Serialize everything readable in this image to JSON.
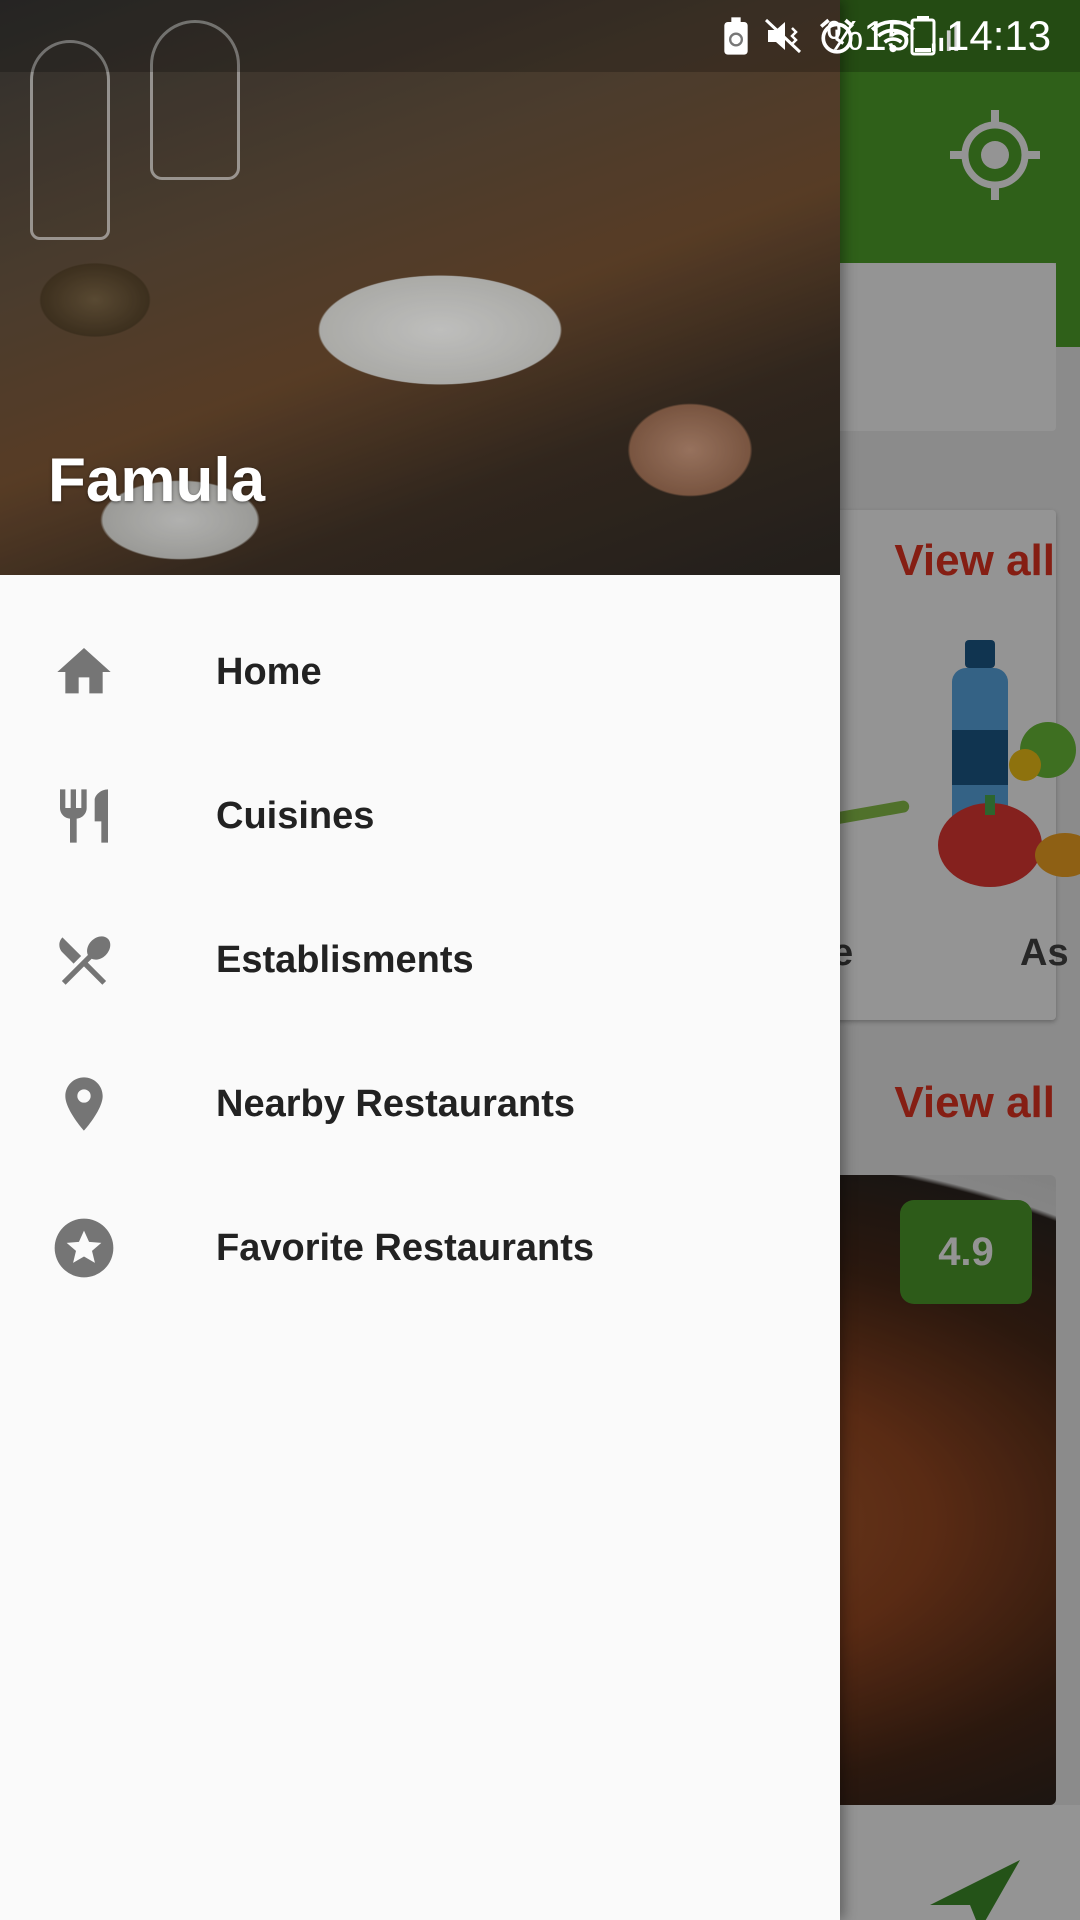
{
  "status_bar": {
    "battery": "%15",
    "time": "14:13"
  },
  "app": {
    "view_all_1": "View all",
    "view_all_2": "View all",
    "cuisine_label_1": "e",
    "cuisine_label_2": "As",
    "rating": "4.9",
    "toolbar_color": "#51a62b",
    "accent_color": "#e53422"
  },
  "drawer": {
    "title": "Famula",
    "items": [
      {
        "label": "Home",
        "icon": "home-icon"
      },
      {
        "label": "Cuisines",
        "icon": "fork-knife-icon"
      },
      {
        "label": "Establisments",
        "icon": "spoon-fork-icon"
      },
      {
        "label": "Nearby Restaurants",
        "icon": "location-pin-icon"
      },
      {
        "label": "Favorite Restaurants",
        "icon": "star-icon"
      }
    ]
  }
}
